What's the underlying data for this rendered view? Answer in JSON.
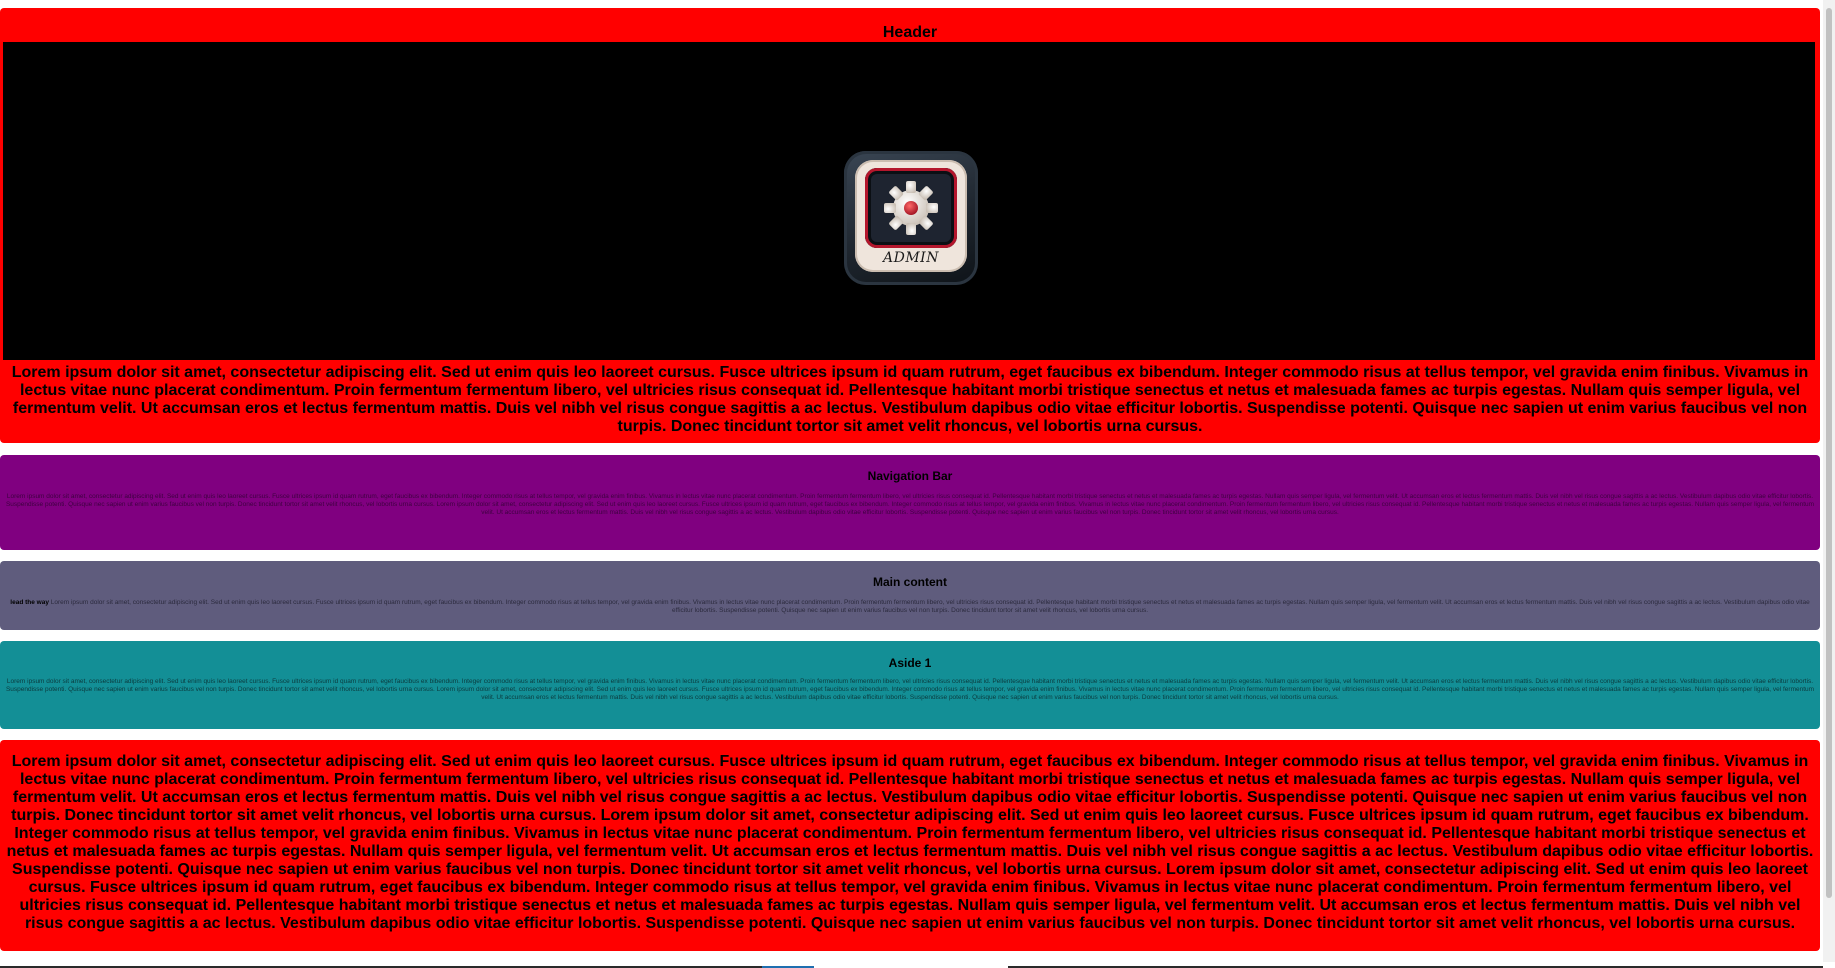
{
  "colors": {
    "header_bg": "#ff0000",
    "nav_bg": "#800080",
    "main_bg": "#5f5c7d",
    "aside_bg": "#138f96",
    "footer_bg": "#ff0000",
    "banner_bg": "#000000"
  },
  "header": {
    "title": "Header",
    "logo_icon": "admin-gear-icon",
    "logo_text": "ADMIN",
    "text": "Lorem ipsum dolor sit amet, consectetur adipiscing elit. Sed ut enim quis leo laoreet cursus. Fusce ultrices ipsum id quam rutrum, eget faucibus ex bibendum. Integer commodo risus at tellus tempor, vel gravida enim finibus. Vivamus in lectus vitae nunc placerat condimentum. Proin fermentum fermentum libero, vel ultricies risus consequat id. Pellentesque habitant morbi tristique senectus et netus et malesuada fames ac turpis egestas. Nullam quis semper ligula, vel fermentum velit. Ut accumsan eros et lectus fermentum mattis. Duis vel nibh vel risus congue sagittis a ac lectus. Vestibulum dapibus odio vitae efficitur lobortis. Suspendisse potenti. Quisque nec sapien ut enim varius faucibus vel non turpis. Donec tincidunt tortor sit amet velit rhoncus, vel lobortis urna cursus."
  },
  "nav": {
    "title": "Navigation Bar",
    "text": "Lorem ipsum dolor sit amet, consectetur adipiscing elit. Sed ut enim quis leo laoreet cursus. Fusce ultrices ipsum id quam rutrum, eget faucibus ex bibendum. Integer commodo risus at tellus tempor, vel gravida enim finibus. Vivamus in lectus vitae nunc placerat condimentum. Proin fermentum fermentum libero, vel ultricies risus consequat id. Pellentesque habitant morbi tristique senectus et netus et malesuada fames ac turpis egestas. Nullam quis semper ligula, vel fermentum velit. Ut accumsan eros et lectus fermentum mattis. Duis vel nibh vel risus congue sagittis a ac lectus. Vestibulum dapibus odio vitae efficitur lobortis. Suspendisse potenti. Quisque nec sapien ut enim varius faucibus vel non turpis. Donec tincidunt tortor sit amet velit rhoncus, vel lobortis urna cursus. Lorem ipsum dolor sit amet, consectetur adipiscing elit. Sed ut enim quis leo laoreet cursus. Fusce ultrices ipsum id quam rutrum, eget faucibus ex bibendum. Integer commodo risus at tellus tempor, vel gravida enim finibus. Vivamus in lectus vitae nunc placerat condimentum. Proin fermentum fermentum libero, vel ultricies risus consequat id. Pellentesque habitant morbi tristique senectus et netus et malesuada fames ac turpis egestas. Nullam quis semper ligula, vel fermentum velit. Ut accumsan eros et lectus fermentum mattis. Duis vel nibh vel risus congue sagittis a ac lectus. Vestibulum dapibus odio vitae efficitur lobortis. Suspendisse potenti. Quisque nec sapien ut enim varius faucibus vel non turpis. Donec tincidunt tortor sit amet velit rhoncus, vel lobortis urna cursus."
  },
  "main": {
    "title": "Main content",
    "lead": "lead the way",
    "text": "Lorem ipsum dolor sit amet, consectetur adipiscing elit. Sed ut enim quis leo laoreet cursus. Fusce ultrices ipsum id quam rutrum, eget faucibus ex bibendum. Integer commodo risus at tellus tempor, vel gravida enim finibus. Vivamus in lectus vitae nunc placerat condimentum. Proin fermentum fermentum libero, vel ultricies risus consequat id. Pellentesque habitant morbi tristique senectus et netus et malesuada fames ac turpis egestas. Nullam quis semper ligula, vel fermentum velit. Ut accumsan eros et lectus fermentum mattis. Duis vel nibh vel risus congue sagittis a ac lectus. Vestibulum dapibus odio vitae efficitur lobortis. Suspendisse potenti. Quisque nec sapien ut enim varius faucibus vel non turpis. Donec tincidunt tortor sit amet velit rhoncus, vel lobortis urna cursus."
  },
  "aside": {
    "title": "Aside 1",
    "text": "Lorem ipsum dolor sit amet, consectetur adipiscing elit. Sed ut enim quis leo laoreet cursus. Fusce ultrices ipsum id quam rutrum, eget faucibus ex bibendum. Integer commodo risus at tellus tempor, vel gravida enim finibus. Vivamus in lectus vitae nunc placerat condimentum. Proin fermentum fermentum libero, vel ultricies risus consequat id. Pellentesque habitant morbi tristique senectus et netus et malesuada fames ac turpis egestas. Nullam quis semper ligula, vel fermentum velit. Ut accumsan eros et lectus fermentum mattis. Duis vel nibh vel risus congue sagittis a ac lectus. Vestibulum dapibus odio vitae efficitur lobortis. Suspendisse potenti. Quisque nec sapien ut enim varius faucibus vel non turpis. Donec tincidunt tortor sit amet velit rhoncus, vel lobortis urna cursus. Lorem ipsum dolor sit amet, consectetur adipiscing elit. Sed ut enim quis leo laoreet cursus. Fusce ultrices ipsum id quam rutrum, eget faucibus ex bibendum. Integer commodo risus at tellus tempor, vel gravida enim finibus. Vivamus in lectus vitae nunc placerat condimentum. Proin fermentum fermentum libero, vel ultricies risus consequat id. Pellentesque habitant morbi tristique senectus et netus et malesuada fames ac turpis egestas. Nullam quis semper ligula, vel fermentum velit. Ut accumsan eros et lectus fermentum mattis. Duis vel nibh vel risus congue sagittis a ac lectus. Vestibulum dapibus odio vitae efficitur lobortis. Suspendisse potenti. Quisque nec sapien ut enim varius faucibus vel non turpis. Donec tincidunt tortor sit amet velit rhoncus, vel lobortis urna cursus."
  },
  "footer": {
    "text": "Lorem ipsum dolor sit amet, consectetur adipiscing elit. Sed ut enim quis leo laoreet cursus. Fusce ultrices ipsum id quam rutrum, eget faucibus ex bibendum. Integer commodo risus at tellus tempor, vel gravida enim finibus. Vivamus in lectus vitae nunc placerat condimentum. Proin fermentum fermentum libero, vel ultricies risus consequat id. Pellentesque habitant morbi tristique senectus et netus et malesuada fames ac turpis egestas. Nullam quis semper ligula, vel fermentum velit. Ut accumsan eros et lectus fermentum mattis. Duis vel nibh vel risus congue sagittis a ac lectus. Vestibulum dapibus odio vitae efficitur lobortis. Suspendisse potenti. Quisque nec sapien ut enim varius faucibus vel non turpis. Donec tincidunt tortor sit amet velit rhoncus, vel lobortis urna cursus. Lorem ipsum dolor sit amet, consectetur adipiscing elit. Sed ut enim quis leo laoreet cursus. Fusce ultrices ipsum id quam rutrum, eget faucibus ex bibendum. Integer commodo risus at tellus tempor, vel gravida enim finibus. Vivamus in lectus vitae nunc placerat condimentum. Proin fermentum fermentum libero, vel ultricies risus consequat id. Pellentesque habitant morbi tristique senectus et netus et malesuada fames ac turpis egestas. Nullam quis semper ligula, vel fermentum velit. Ut accumsan eros et lectus fermentum mattis. Duis vel nibh vel risus congue sagittis a ac lectus. Vestibulum dapibus odio vitae efficitur lobortis. Suspendisse potenti. Quisque nec sapien ut enim varius faucibus vel non turpis. Donec tincidunt tortor sit amet velit rhoncus, vel lobortis urna cursus. Lorem ipsum dolor sit amet, consectetur adipiscing elit. Sed ut enim quis leo laoreet cursus. Fusce ultrices ipsum id quam rutrum, eget faucibus ex bibendum. Integer commodo risus at tellus tempor, vel gravida enim finibus. Vivamus in lectus vitae nunc placerat condimentum. Proin fermentum fermentum libero, vel ultricies risus consequat id. Pellentesque habitant morbi tristique senectus et netus et malesuada fames ac turpis egestas. Nullam quis semper ligula, vel fermentum velit. Ut accumsan eros et lectus fermentum mattis. Duis vel nibh vel risus congue sagittis a ac lectus. Vestibulum dapibus odio vitae efficitur lobortis. Suspendisse potenti. Quisque nec sapien ut enim varius faucibus vel non turpis. Donec tincidunt tortor sit amet velit rhoncus, vel lobortis urna cursus."
  }
}
